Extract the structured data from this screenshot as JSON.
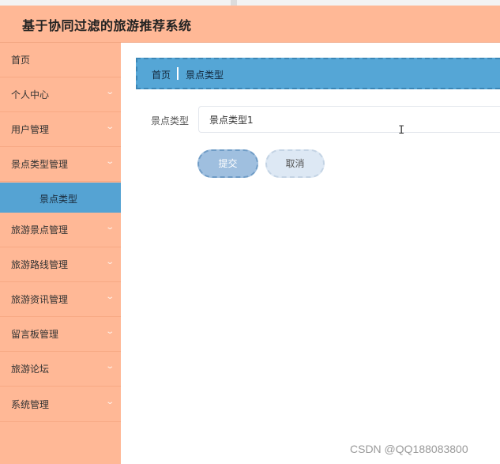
{
  "header": {
    "title": "基于协同过滤的旅游推荐系统"
  },
  "sidebar": {
    "items": [
      {
        "label": "首页",
        "chevron": false
      },
      {
        "label": "个人中心",
        "chevron": true
      },
      {
        "label": "用户管理",
        "chevron": true
      },
      {
        "label": "景点类型管理",
        "chevron": true
      },
      {
        "label": "旅游景点管理",
        "chevron": true
      },
      {
        "label": "旅游路线管理",
        "chevron": true
      },
      {
        "label": "旅游资讯管理",
        "chevron": true
      },
      {
        "label": "留言板管理",
        "chevron": true
      },
      {
        "label": "旅游论坛",
        "chevron": true
      },
      {
        "label": "系统管理",
        "chevron": true
      }
    ],
    "active_submenu": {
      "label": "景点类型"
    },
    "chevron_glyph": "⌄"
  },
  "breadcrumb": {
    "home": "首页",
    "current": "景点类型"
  },
  "form": {
    "type_label": "景点类型",
    "type_value": "景点类型1",
    "submit_label": "提交",
    "cancel_label": "取消"
  },
  "watermark": "CSDN @QQ188083800",
  "colors": {
    "header_bg": "#ffb896",
    "sidebar_bg": "#ffb896",
    "active_submenu_bg": "#55a3d3",
    "breadcrumb_bg": "#55a6d6",
    "submit_bg": "#9fbfdf",
    "cancel_bg": "#dde8f4"
  }
}
